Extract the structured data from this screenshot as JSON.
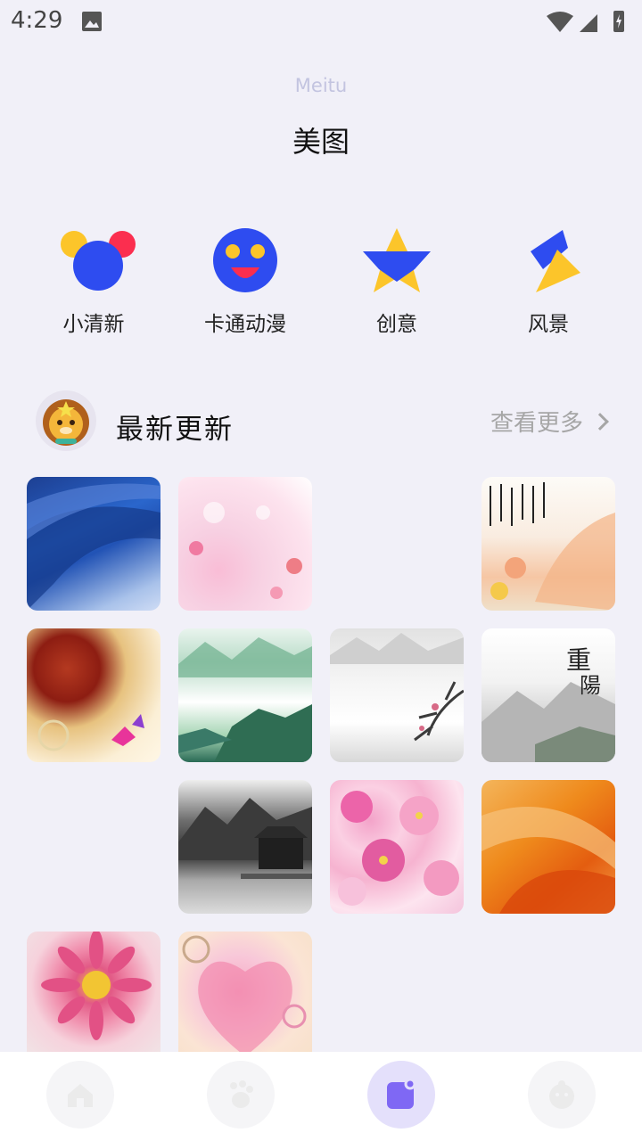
{
  "status_bar": {
    "time": "4:29"
  },
  "header": {
    "subtitle": "Meitu",
    "title": "美图"
  },
  "categories": [
    {
      "label": "小清新",
      "icon": "mickey-blob-icon"
    },
    {
      "label": "卡通动漫",
      "icon": "smiley-face-icon"
    },
    {
      "label": "创意",
      "icon": "star-icon"
    },
    {
      "label": "风景",
      "icon": "lightning-icon"
    }
  ],
  "latest": {
    "title": "最新更新",
    "more_label": "查看更多"
  },
  "thumbnails": [
    "blue-silk",
    "pink-floral",
    "chinese-calligraphy-landscape",
    "red-sun-butterfly",
    "green-mountain-lake",
    "ink-plum-blossom",
    "ink-mountain-chongyang",
    "ink-pagoda-mountain",
    "pink-flowers",
    "orange-silk",
    "pink-gerbera",
    "pink-heart-watercolor"
  ],
  "bottom_nav": [
    {
      "name": "home",
      "icon": "home-icon",
      "active": false
    },
    {
      "name": "footprint",
      "icon": "footprint-icon",
      "active": false
    },
    {
      "name": "wallpaper",
      "icon": "wallpaper-icon",
      "active": true
    },
    {
      "name": "profile",
      "icon": "face-icon",
      "active": false
    }
  ],
  "colors": {
    "background": "#f1f0f8",
    "accent_blue": "#2e4cf0",
    "accent_yellow": "#fcc52a",
    "accent_red": "#fb2e4f",
    "nav_active": "#7f68f4"
  }
}
